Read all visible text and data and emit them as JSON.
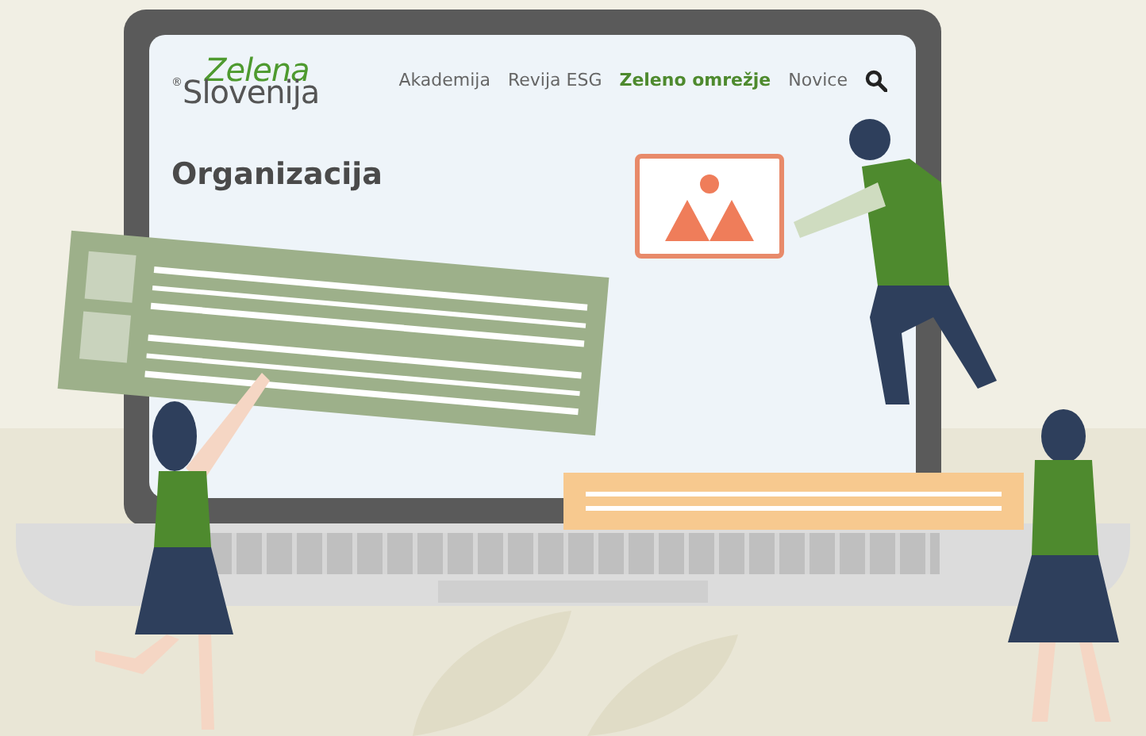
{
  "logo": {
    "mark": "®",
    "top": "Zelena",
    "bottom": "Slovenija"
  },
  "nav": [
    {
      "label": "Akademija",
      "selected": false
    },
    {
      "label": "Revija ESG",
      "selected": false
    },
    {
      "label": "Zeleno omrežje",
      "selected": true
    },
    {
      "label": "Novice",
      "selected": false
    }
  ],
  "heading": "Organizacija"
}
